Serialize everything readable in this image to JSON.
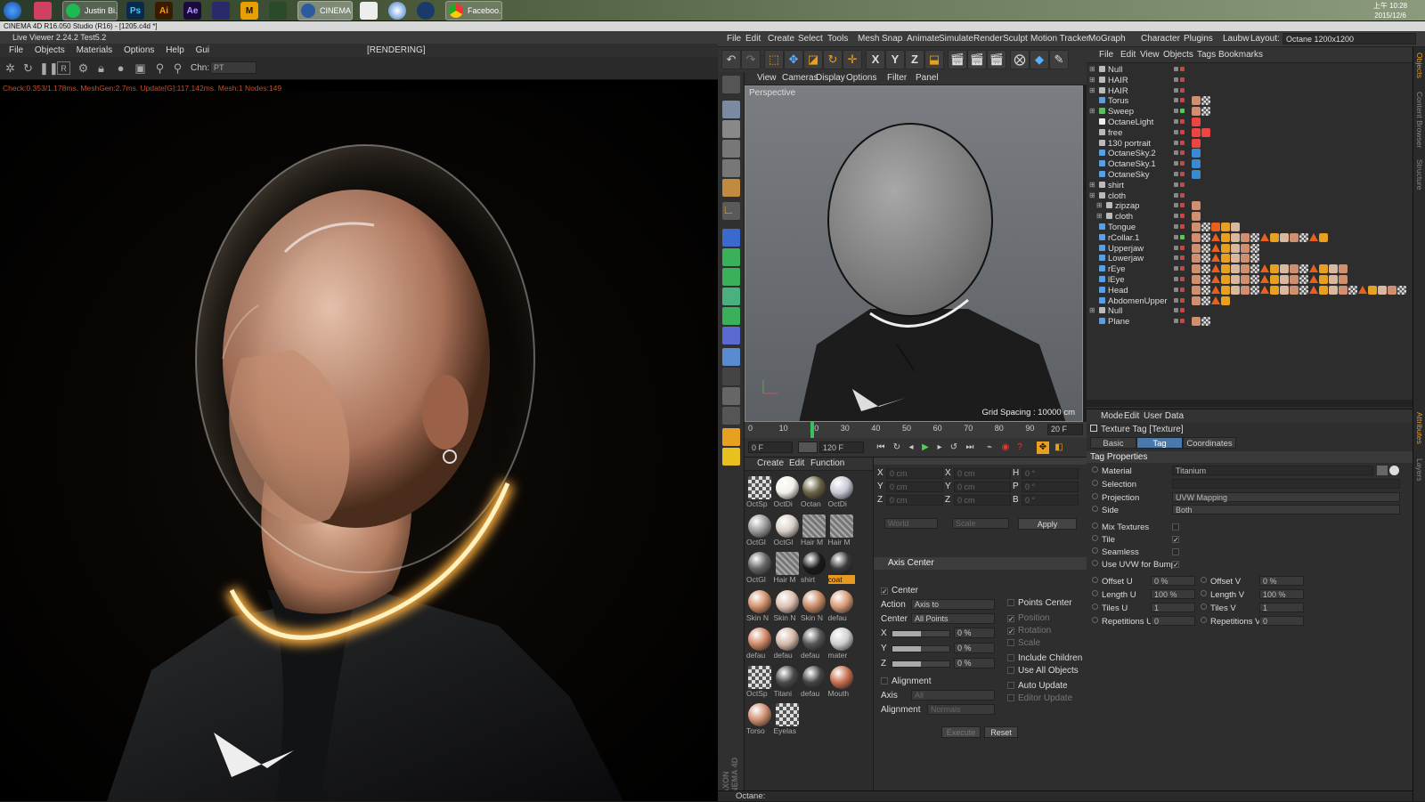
{
  "taskbar": {
    "tasks": [
      "Justin Bi...",
      "CINEMA ...",
      "Faceboo..."
    ],
    "apps": [
      "Ps",
      "Ai",
      "Ae",
      "M"
    ],
    "clock_time": "上午 10:28",
    "clock_date": "2015/12/6",
    "clock_day": "星期日"
  },
  "window_title": "CINEMA 4D R16.050 Studio (R16) - [1205.c4d *]",
  "live_viewer": {
    "title": "Live Viewer 2.24.2 Test5.2",
    "menu": [
      "File",
      "Objects",
      "Materials",
      "Options",
      "Help",
      "Gui"
    ],
    "state": "[RENDERING]",
    "channel_label": "Chn:",
    "channel_value": "PT",
    "stats": "Check:0.353/1.178ms. MeshGen:2.7ms. Update[G]:117.142ms. Mesh:1 Nodes:149"
  },
  "main_menu": [
    "File",
    "Edit",
    "Create",
    "Select",
    "Tools",
    "Mesh",
    "Snap",
    "Animate",
    "Simulate",
    "Render",
    "Sculpt",
    "Motion Tracker",
    "MoGraph",
    "Character",
    "Plugins",
    "Laubw"
  ],
  "layout_label": "Layout:",
  "layout_value": "Octane 1200x1200",
  "toolbar_axes": [
    "X",
    "Y",
    "Z"
  ],
  "viewport": {
    "menu": [
      "View",
      "Cameras",
      "Display",
      "Options",
      "Filter",
      "Panel"
    ],
    "camera": "Perspective",
    "grid_spacing": "Grid Spacing : 10000 cm"
  },
  "timeline": {
    "ticks": [
      "0",
      "10",
      "20",
      "30",
      "40",
      "50",
      "60",
      "70",
      "80",
      "90"
    ],
    "end_frame": "20 F",
    "current": "0 F",
    "max": "120 F"
  },
  "materials": {
    "menu": [
      "Create",
      "Edit",
      "Function"
    ],
    "items": [
      {
        "name": "OctSp",
        "color": "#999999",
        "pattern": "check"
      },
      {
        "name": "OctDi",
        "color": "#f2f0ea",
        "pattern": "plain"
      },
      {
        "name": "Octan",
        "color": "#6a6244",
        "pattern": "plain"
      },
      {
        "name": "OctDi",
        "color": "#c8c8d6",
        "pattern": "plain"
      },
      {
        "name": "OctGl",
        "color": "#9a9a9a",
        "pattern": "plain"
      },
      {
        "name": "OctGl",
        "color": "#d8d0c8",
        "pattern": "plain"
      },
      {
        "name": "Hair M",
        "color": "#777777",
        "pattern": "stripe"
      },
      {
        "name": "Hair M",
        "color": "#777777",
        "pattern": "stripe"
      },
      {
        "name": "OctGl",
        "color": "#666666",
        "pattern": "plain"
      },
      {
        "name": "Hair M",
        "color": "#777777",
        "pattern": "stripe"
      },
      {
        "name": "shirt",
        "color": "#1a1a1a",
        "pattern": "plain"
      },
      {
        "name": "coat",
        "color": "#3a3a3a",
        "pattern": "plain"
      },
      {
        "name": "Skin N",
        "color": "#d0906a",
        "pattern": "plain"
      },
      {
        "name": "Skin N",
        "color": "#dcc0b0",
        "pattern": "plain"
      },
      {
        "name": "Skin N",
        "color": "#c88a66",
        "pattern": "plain"
      },
      {
        "name": "defau",
        "color": "#d89a78",
        "pattern": "plain"
      },
      {
        "name": "defau",
        "color": "#d08866",
        "pattern": "plain"
      },
      {
        "name": "defau",
        "color": "#d4b8a8",
        "pattern": "plain"
      },
      {
        "name": "defau",
        "color": "#555555",
        "pattern": "plain"
      },
      {
        "name": "mater",
        "color": "#cfcfcf",
        "pattern": "plain"
      },
      {
        "name": "OctSp",
        "color": "#aaaaaa",
        "pattern": "check"
      },
      {
        "name": "Titani",
        "color": "#4a4a4a",
        "pattern": "plain"
      },
      {
        "name": "defau",
        "color": "#444444",
        "pattern": "plain"
      },
      {
        "name": "Mouth",
        "color": "#c87050",
        "pattern": "plain"
      },
      {
        "name": "Torso",
        "color": "#d09070",
        "pattern": "plain"
      },
      {
        "name": "Eyelas",
        "color": "#aaaaaa",
        "pattern": "check"
      }
    ],
    "selected_index": 11
  },
  "coords": {
    "rows": [
      {
        "a": "X",
        "av": "0 cm",
        "b": "X",
        "bv": "0 cm",
        "c": "H",
        "cv": "0 °"
      },
      {
        "a": "Y",
        "av": "0 cm",
        "b": "Y",
        "bv": "0 cm",
        "c": "P",
        "cv": "0 °"
      },
      {
        "a": "Z",
        "av": "0 cm",
        "b": "Z",
        "bv": "0 cm",
        "c": "B",
        "cv": "0 °"
      }
    ],
    "mode1": "World",
    "mode2": "Scale",
    "apply": "Apply"
  },
  "axis_center": {
    "title": "Axis Center",
    "center": "Center",
    "action_label": "Action",
    "action": "Axis to",
    "center_label": "Center",
    "center_value": "All Points",
    "points_center": "Points Center",
    "position": "Position",
    "rotation": "Rotation",
    "scale": "Scale",
    "x": "X",
    "y": "Y",
    "z": "Z",
    "xv": "0 %",
    "yv": "0 %",
    "zv": "0 %",
    "include_children": "Include Children",
    "use_all_objects": "Use All Objects",
    "alignment": "Alignment",
    "axis_label": "Axis",
    "axis_value": "All",
    "alignment_label": "Alignment",
    "alignment_value": "Normals",
    "auto_update": "Auto Update",
    "editor_update": "Editor Update",
    "execute": "Execute",
    "reset": "Reset"
  },
  "object_manager": {
    "menu": [
      "File",
      "Edit",
      "View",
      "Objects",
      "Tags",
      "Bookmarks"
    ],
    "objects": [
      {
        "name": "Null",
        "icon": "#bbbbbb",
        "indent": 0,
        "expand": true
      },
      {
        "name": "HAIR",
        "icon": "#bbbbbb",
        "indent": 0,
        "expand": true
      },
      {
        "name": "HAIR",
        "icon": "#bbbbbb",
        "indent": 0,
        "expand": true
      },
      {
        "name": "Torus",
        "icon": "#5aa0e0",
        "indent": 0,
        "expand": false
      },
      {
        "name": "Sweep",
        "icon": "#5ac05a",
        "indent": 0,
        "expand": true
      },
      {
        "name": "OctaneLight",
        "icon": "#eeeeee",
        "indent": 0,
        "expand": false
      },
      {
        "name": "free",
        "icon": "#bbbbbb",
        "indent": 0,
        "expand": false
      },
      {
        "name": "130 portrait",
        "icon": "#bbbbbb",
        "indent": 0,
        "expand": false
      },
      {
        "name": "OctaneSky.2",
        "icon": "#5aa0e0",
        "indent": 0,
        "expand": false
      },
      {
        "name": "OctaneSky.1",
        "icon": "#5aa0e0",
        "indent": 0,
        "expand": false
      },
      {
        "name": "OctaneSky",
        "icon": "#5aa0e0",
        "indent": 0,
        "expand": false
      },
      {
        "name": "shirt",
        "icon": "#bbbbbb",
        "indent": 0,
        "expand": true
      },
      {
        "name": "cloth",
        "icon": "#bbbbbb",
        "indent": 0,
        "expand": true
      },
      {
        "name": "zipzap",
        "icon": "#bbbbbb",
        "indent": 1,
        "expand": true
      },
      {
        "name": "cloth",
        "icon": "#bbbbbb",
        "indent": 1,
        "expand": true
      },
      {
        "name": "Tongue",
        "icon": "#5aa0e0",
        "indent": 0,
        "expand": false
      },
      {
        "name": "rCollar.1",
        "icon": "#5aa0e0",
        "indent": 0,
        "expand": false
      },
      {
        "name": "Upperjaw",
        "icon": "#5aa0e0",
        "indent": 0,
        "expand": false
      },
      {
        "name": "Lowerjaw",
        "icon": "#5aa0e0",
        "indent": 0,
        "expand": false
      },
      {
        "name": "rEye",
        "icon": "#5aa0e0",
        "indent": 0,
        "expand": false
      },
      {
        "name": "lEye",
        "icon": "#5aa0e0",
        "indent": 0,
        "expand": false
      },
      {
        "name": "Head",
        "icon": "#5aa0e0",
        "indent": 0,
        "expand": false
      },
      {
        "name": "AbdomenUpper",
        "icon": "#5aa0e0",
        "indent": 0,
        "expand": false
      },
      {
        "name": "Null",
        "icon": "#bbbbbb",
        "indent": 0,
        "expand": true
      },
      {
        "name": "Plane",
        "icon": "#5aa0e0",
        "indent": 0,
        "expand": false
      }
    ]
  },
  "attributes": {
    "menu": [
      "Mode",
      "Edit",
      "User Data"
    ],
    "header": "Texture Tag [Texture]",
    "tabs": [
      "Basic",
      "Tag",
      "Coordinates"
    ],
    "active_tab": 1,
    "section": "Tag Properties",
    "material_label": "Material",
    "material_value": "Titanium",
    "selection_label": "Selection",
    "projection_label": "Projection",
    "projection_value": "UVW Mapping",
    "side_label": "Side",
    "side_value": "Both",
    "mix_textures": "Mix Textures",
    "tile": "Tile",
    "seamless": "Seamless",
    "use_uvw": "Use UVW for Bump",
    "offset_u": "Offset U",
    "offset_u_v": "0 %",
    "offset_v": "Offset V",
    "offset_v_v": "0 %",
    "length_u": "Length U",
    "length_u_v": "100 %",
    "length_v": "Length V",
    "length_v_v": "100 %",
    "tiles_u": "Tiles U",
    "tiles_u_v": "1",
    "tiles_v": "Tiles V",
    "tiles_v_v": "1",
    "rep_u": "Repetitions U",
    "rep_u_v": "0",
    "rep_v": "Repetitions V",
    "rep_v_v": "0"
  },
  "right_tabs": [
    "Objects",
    "Content Browser",
    "Structure",
    "Attributes",
    "Layers"
  ],
  "status": "Octane:"
}
